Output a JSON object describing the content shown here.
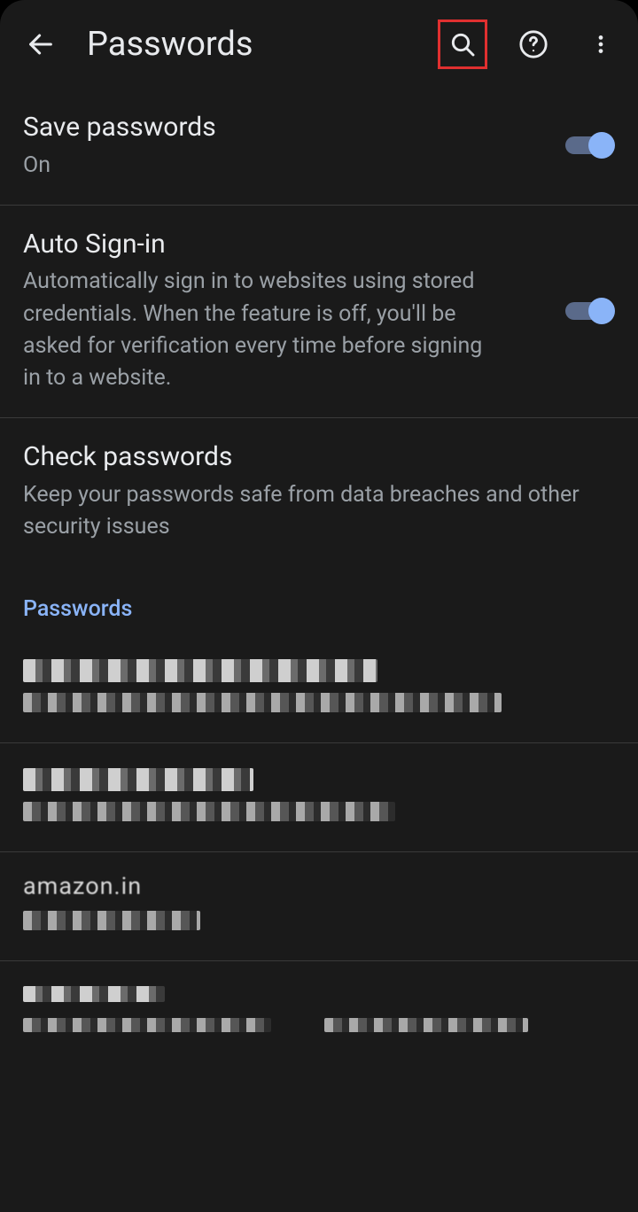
{
  "header": {
    "title": "Passwords"
  },
  "settings": {
    "save_passwords": {
      "title": "Save passwords",
      "status": "On",
      "enabled": true
    },
    "auto_signin": {
      "title": "Auto Sign-in",
      "description": "Automatically sign in to websites using stored credentials. When the feature is off, you'll be asked for verification every time before signing in to a website.",
      "enabled": true
    },
    "check_passwords": {
      "title": "Check passwords",
      "description": "Keep your passwords safe from data breaches and other security issues"
    }
  },
  "passwords_section_label": "Passwords",
  "password_entries": [
    {
      "site": "[redacted]",
      "user": "[redacted]"
    },
    {
      "site": "[redacted]",
      "user": "[redacted]"
    },
    {
      "site": "amazon.in",
      "user": "[redacted]"
    },
    {
      "site": "[redacted]",
      "user": "[redacted]"
    }
  ]
}
